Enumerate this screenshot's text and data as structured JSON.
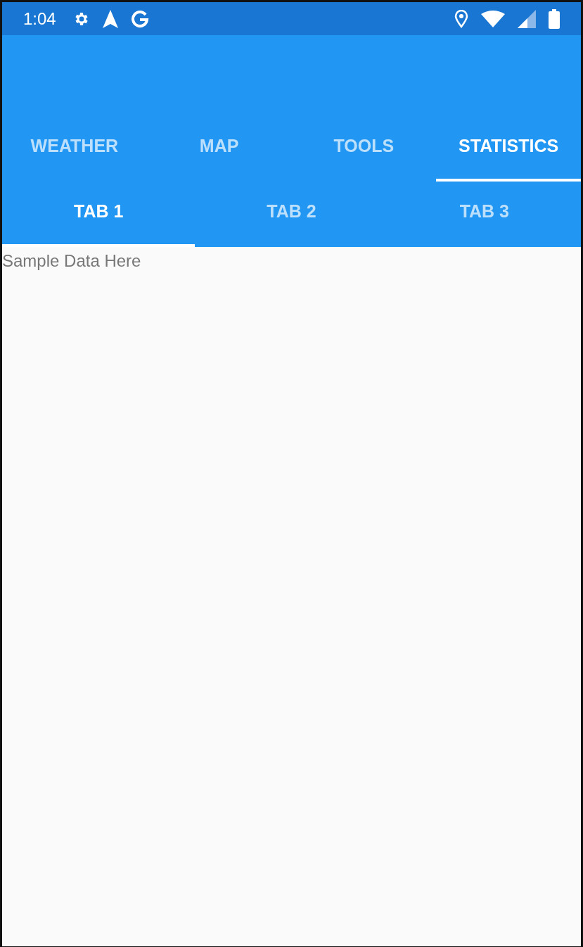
{
  "status_bar": {
    "time": "1:04"
  },
  "tabs": [
    {
      "label": "WEATHER",
      "selected": false
    },
    {
      "label": "MAP",
      "selected": false
    },
    {
      "label": "TOOLS",
      "selected": false
    },
    {
      "label": "STATISTICS",
      "selected": true
    }
  ],
  "sub_tabs": [
    {
      "label": "TAB 1",
      "selected": true
    },
    {
      "label": "TAB 2",
      "selected": false
    },
    {
      "label": "TAB 3",
      "selected": false
    }
  ],
  "content": {
    "text": "Sample Data Here"
  }
}
